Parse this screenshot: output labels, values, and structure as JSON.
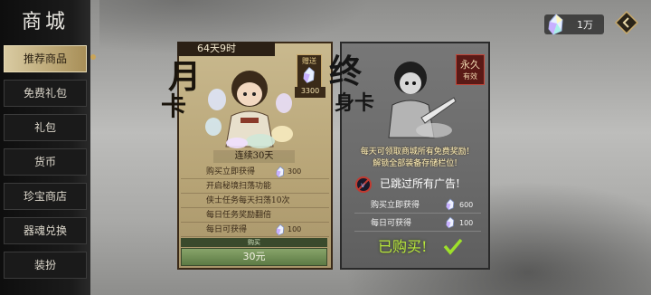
{
  "sidebar": {
    "title": "商城",
    "items": [
      {
        "label": "推荐商品",
        "active": true
      },
      {
        "label": "免费礼包",
        "active": false
      },
      {
        "label": "礼包",
        "active": false
      },
      {
        "label": "货币",
        "active": false
      },
      {
        "label": "珍宝商店",
        "active": false
      },
      {
        "label": "器魂兑换",
        "active": false
      },
      {
        "label": "装扮",
        "active": false
      }
    ]
  },
  "header": {
    "currency_amount": "1万",
    "currency_icon": "crystal-gem-icon",
    "close_icon": "close-arrow-icon"
  },
  "monthly_card": {
    "timer": "64天9时",
    "title_char1": "月",
    "title_char2": "卡",
    "gem_tag_label": "赠送",
    "gem_tag_amount": "3300",
    "sub_title": "连续30天",
    "rows": [
      {
        "text": "购买立即获得",
        "value": "300",
        "has_gem": true
      },
      {
        "text": "开启秘境扫荡功能",
        "value": "",
        "has_gem": false
      },
      {
        "text": "侠士任务每天扫荡10次",
        "value": "",
        "has_gem": false
      },
      {
        "text": "每日任务奖励翻倍",
        "value": "",
        "has_gem": false
      },
      {
        "text": "每日可获得",
        "value": "100",
        "has_gem": true
      }
    ],
    "buy_label": "购买",
    "price": "30元"
  },
  "lifetime_card": {
    "title_char1": "终",
    "title_char2": "身卡",
    "perm_tag_line1": "永久",
    "perm_tag_line2": "有效",
    "desc_line1": "每天可领取商城所有免费奖励!",
    "desc_line2": "解锁全部装备存储栏位!",
    "ad_text": "已跳过所有广告!",
    "rows": [
      {
        "text": "购买立即获得",
        "value": "600"
      },
      {
        "text": "每日可获得",
        "value": "100"
      }
    ],
    "status": "已购买!"
  },
  "colors": {
    "active_tab": "#d9cba2",
    "buy_button": "#6e8c52",
    "purchased_text": "#b8e63c",
    "perm_tag": "#5a1a16"
  }
}
